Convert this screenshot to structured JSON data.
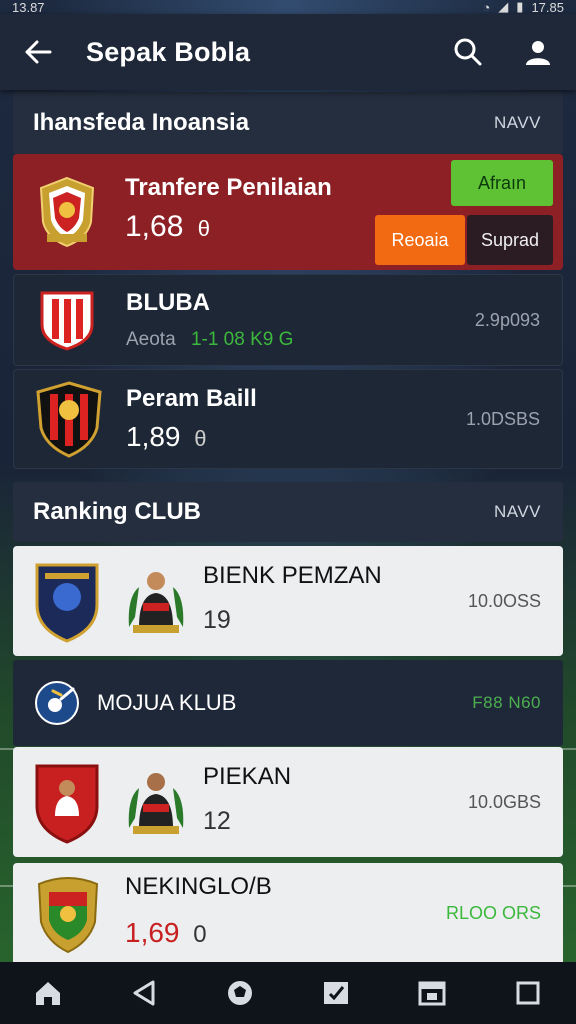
{
  "status": {
    "time": "13.87",
    "clock": "17.85"
  },
  "app_bar": {
    "title": "Sepak Bobla"
  },
  "transfer_section": {
    "title": "Ihansfeda Inoansia",
    "action": "NAVV"
  },
  "featured": {
    "name": "Tranfere Penilaian",
    "value": "1,68",
    "value_suffix": "θ",
    "btn_green": "Afraın",
    "btn_orange": "Reoaia",
    "btn_dark": "Suprad"
  },
  "transfer_items": [
    {
      "name": "BLUBA",
      "sub_label": "Aeota",
      "sub_value": "1-1 08 K9 G",
      "meta": "2.9p093"
    },
    {
      "name": "Peram Baill",
      "value": "1,89",
      "value_suffix": "θ",
      "meta": "1.0DSBS"
    }
  ],
  "ranking_section": {
    "title": "Ranking CLUB",
    "action": "NAVV"
  },
  "ranking_items": [
    {
      "name": "BIENK PEMZAN",
      "rank": "19",
      "meta": "10.0OSS"
    },
    {
      "name": "PIEKAN",
      "rank": "12",
      "meta": "10.0GBS"
    },
    {
      "name": "NEKINGLO/B",
      "value": "1,69",
      "value_suffix": "0",
      "meta": "RLOO ORS"
    }
  ],
  "club_section": {
    "title": "MOJUA KLUB",
    "action": "F88 N60"
  },
  "colors": {
    "featured_bg": "#8c2024",
    "accent_green": "#5fc235",
    "accent_orange": "#f26a12",
    "positive": "#3cb83c"
  },
  "bottom_nav": [
    "home-icon",
    "back-icon",
    "ball-icon",
    "inbox-icon",
    "calendar-icon",
    "square-icon"
  ]
}
